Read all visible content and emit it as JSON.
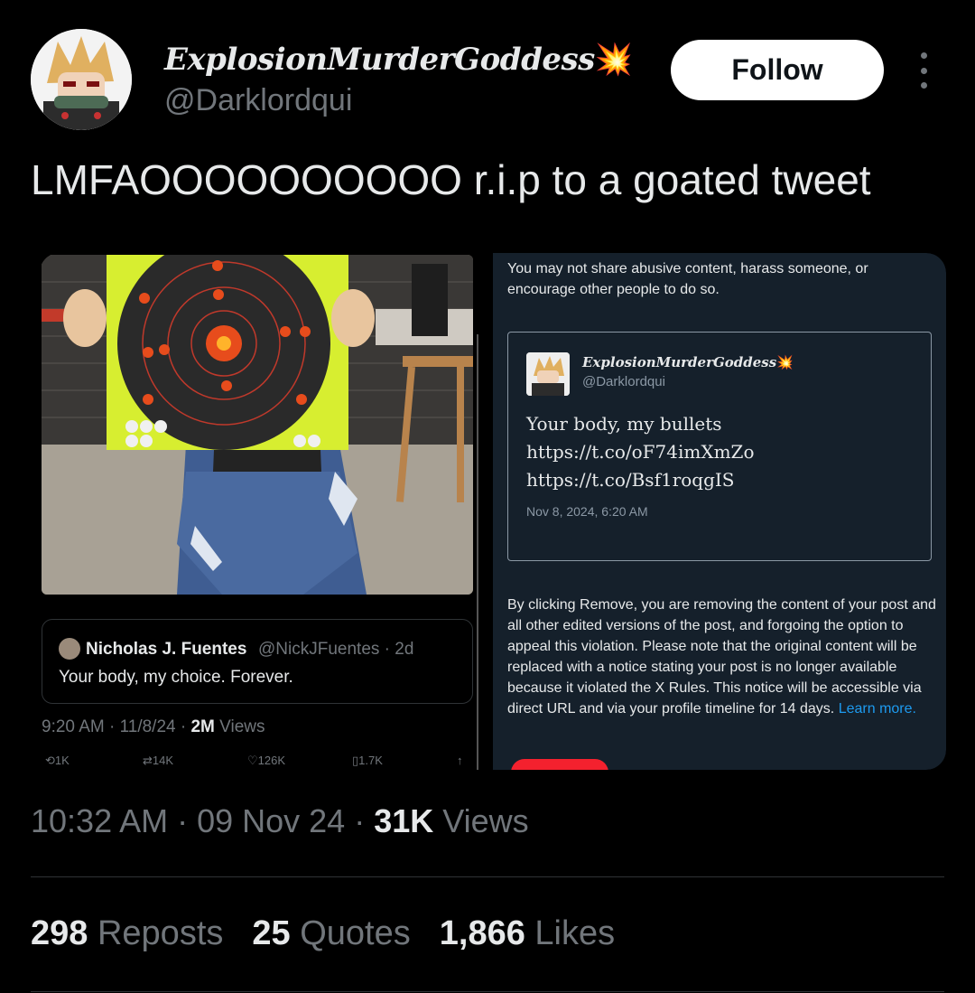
{
  "author": {
    "display_name": "ExplosionMurderGoddess",
    "name_emoji": "💥",
    "handle": "@Darklordqui",
    "avatar_icon": "anime-character-avatar"
  },
  "header": {
    "follow_label": "Follow",
    "more_icon": "more-vertical-icon"
  },
  "tweet": {
    "text": "LMFAOOOOOOOOOO r.i.p to a goated tweet"
  },
  "media": {
    "left": {
      "photo_icon": "target-photo",
      "quote": {
        "name": "Nicholas J. Fuentes",
        "handle": "@NickJFuentes · 2d",
        "text": "Your body, my choice. Forever."
      },
      "meta_time": "9:20 AM · 11/8/24 · ",
      "meta_views_num": "2M",
      "meta_views_label": " Views",
      "actions": {
        "reply": "1K",
        "repost": "14K",
        "like": "126K",
        "bookmark": "1.7K"
      }
    },
    "right": {
      "policy_text": "You may not share abusive content, harass someone, or encourage other people to do so.",
      "card": {
        "name": "ExplosionMurderGoddess",
        "name_emoji": "💥",
        "handle": "@Darklordqui",
        "lines": [
          "Your body, my bullets",
          "https://t.co/oF74imXmZo",
          "https://t.co/Bsf1roqgIS"
        ],
        "date": "Nov 8, 2024, 6:20 AM"
      },
      "remove_text": "By clicking Remove, you are removing the content of your post and all other edited versions of the post, and forgoing the option to appeal this violation. Please note that the original content will be replaced with a notice stating your post is no longer available because it violated the X Rules. This notice will be accessible via direct URL and via your profile timeline for 14 days.",
      "learn_more": "Learn more."
    }
  },
  "meta": {
    "time_date": "10:32 AM · 09 Nov 24 · ",
    "views_num": "31K",
    "views_label": " Views"
  },
  "stats": {
    "reposts_num": "298",
    "reposts_label": "Reposts",
    "quotes_num": "25",
    "quotes_label": "Quotes",
    "likes_num": "1,866",
    "likes_label": "Likes"
  },
  "colors": {
    "background": "#000000",
    "text": "#e7e9ea",
    "muted": "#71767b",
    "dim_panel": "#15202b",
    "link": "#1d9bf0"
  }
}
